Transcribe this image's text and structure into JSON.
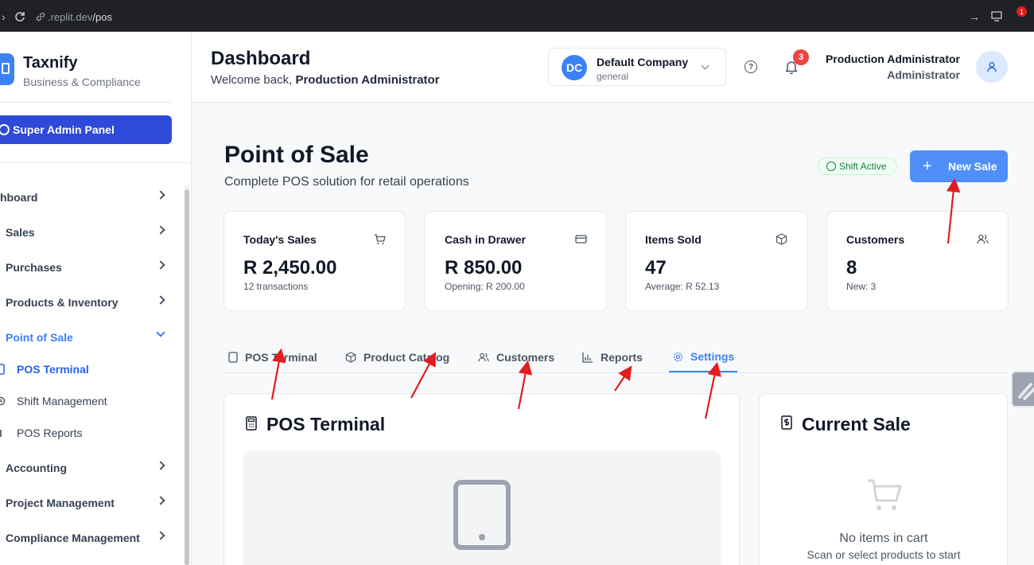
{
  "browser": {
    "url_domain": ".replit.dev",
    "url_path": "/pos",
    "ext_badge": "1"
  },
  "sidebar": {
    "brand": "Taxnify",
    "tagline": "Business & Compliance",
    "super_admin_label": "Super Admin Panel",
    "items": [
      {
        "label": "hboard"
      },
      {
        "label": "Sales"
      },
      {
        "label": "Purchases"
      },
      {
        "label": "Products & Inventory"
      },
      {
        "label": "Point of Sale"
      },
      {
        "label": "Accounting"
      },
      {
        "label": "Project Management"
      },
      {
        "label": "Compliance Management"
      }
    ],
    "subitems": [
      {
        "label": "POS Terminal"
      },
      {
        "label": "Shift Management"
      },
      {
        "label": "POS Reports"
      }
    ]
  },
  "header": {
    "title": "Dashboard",
    "welcome_prefix": "Welcome back, ",
    "welcome_name": "Production Administrator",
    "company_initials": "DC",
    "company_name": "Default Company",
    "company_type": "general",
    "help_glyph": "?",
    "notification_count": "3",
    "user_name": "Production Administrator",
    "user_role": "Administrator"
  },
  "page": {
    "title": "Point of Sale",
    "subtitle": "Complete POS solution for retail operations",
    "shift_status": "Shift Active",
    "new_sale_label": "New Sale",
    "new_sale_plus": "+"
  },
  "cards": [
    {
      "title": "Today's Sales",
      "value": "R 2,450.00",
      "sub": "12 transactions",
      "icon": "cart-icon"
    },
    {
      "title": "Cash in Drawer",
      "value": "R 850.00",
      "sub": "Opening: R 200.00",
      "icon": "credit-card-icon"
    },
    {
      "title": "Items Sold",
      "value": "47",
      "sub": "Average: R 52.13",
      "icon": "box-icon"
    },
    {
      "title": "Customers",
      "value": "8",
      "sub": "New: 3",
      "icon": "users-icon"
    }
  ],
  "tabs": [
    {
      "label": "POS Terminal"
    },
    {
      "label": "Product Catalog"
    },
    {
      "label": "Customers"
    },
    {
      "label": "Reports"
    },
    {
      "label": "Settings"
    }
  ],
  "terminal_panel": {
    "title": "POS Terminal"
  },
  "cart_panel": {
    "title": "Current Sale",
    "empty_text": "No items in cart",
    "hint": "Scan or select products to start"
  },
  "colors": {
    "accent": "#3b82f6",
    "super_admin": "#2f4ad8",
    "badge": "#ef4444",
    "success": "#15803d",
    "annotation_arrow": "#e11d1d"
  }
}
